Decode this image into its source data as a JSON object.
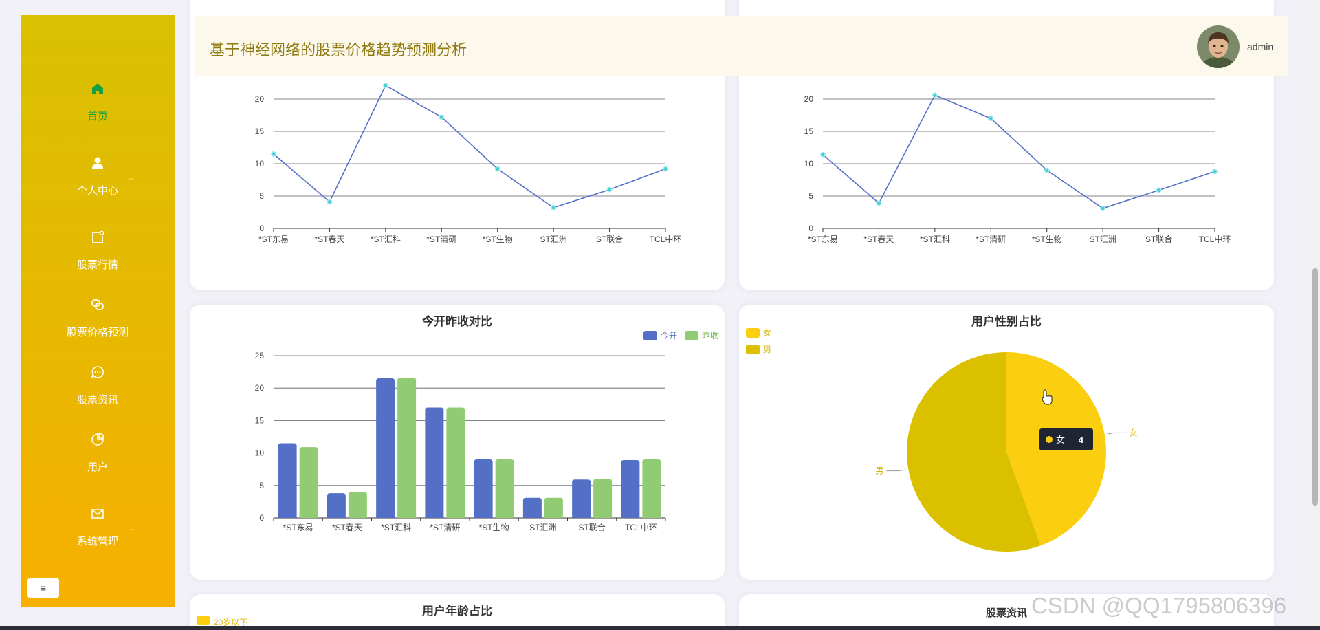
{
  "header": {
    "title": "基于神经网络的股票价格趋势预测分析",
    "username": "admin"
  },
  "sidebar": {
    "items": [
      {
        "label": "首页",
        "icon": "home-icon",
        "active": true
      },
      {
        "label": "个人中心",
        "icon": "user-icon"
      },
      {
        "label": "股票行情",
        "icon": "stock-doc-icon"
      },
      {
        "label": "股票价格预测",
        "icon": "link-icon"
      },
      {
        "label": "股票资讯",
        "icon": "chat-icon"
      },
      {
        "label": "用户",
        "icon": "pie-icon"
      },
      {
        "label": "系统管理",
        "icon": "mail-icon"
      }
    ],
    "collapse_label": "≡",
    "colors": {
      "top": "#d9c000",
      "bottom": "#f7b000",
      "active_text": "#14a047"
    }
  },
  "chart_data": [
    {
      "type": "line",
      "categories": [
        "*ST东易",
        "*ST春天",
        "*ST汇科",
        "*ST清研",
        "*ST生物",
        "ST汇洲",
        "ST联合",
        "TCL中环"
      ],
      "values": [
        11.5,
        4.1,
        22.1,
        17.2,
        9.2,
        3.2,
        6.0,
        9.2
      ],
      "ylim": [
        0,
        20
      ],
      "yticks": [
        0,
        5,
        10,
        15,
        20
      ],
      "grid": true
    },
    {
      "type": "line",
      "categories": [
        "*ST东易",
        "*ST春天",
        "*ST汇科",
        "*ST清研",
        "*ST生物",
        "ST汇洲",
        "ST联合",
        "TCL中环"
      ],
      "values": [
        11.4,
        3.9,
        20.6,
        17.0,
        9.0,
        3.1,
        5.9,
        8.8
      ],
      "ylim": [
        0,
        20
      ],
      "yticks": [
        0,
        5,
        10,
        15,
        20
      ],
      "grid": true
    },
    {
      "type": "bar",
      "title": "今开昨收对比",
      "categories": [
        "*ST东易",
        "*ST春天",
        "*ST汇科",
        "*ST清研",
        "*ST生物",
        "ST汇洲",
        "ST联合",
        "TCL中环"
      ],
      "series": [
        {
          "name": "今开",
          "color": "#5470c6",
          "values": [
            11.5,
            3.8,
            21.5,
            17.0,
            9.0,
            3.1,
            5.9,
            8.9
          ]
        },
        {
          "name": "昨收",
          "color": "#91cc75",
          "values": [
            10.9,
            4.0,
            21.6,
            17.0,
            9.0,
            3.1,
            6.0,
            9.0
          ]
        }
      ],
      "ylim": [
        0,
        25
      ],
      "yticks": [
        0,
        5,
        10,
        15,
        20,
        25
      ],
      "legend": "top-right",
      "grid": true
    },
    {
      "type": "pie",
      "title": "用户性别占比",
      "slices": [
        {
          "name": "女",
          "value": 4,
          "color": "#fcce10"
        },
        {
          "name": "男",
          "value": 5,
          "color": "#dbc000"
        }
      ],
      "legend": "top-left",
      "tooltip": {
        "name": "女",
        "value": 4
      }
    },
    {
      "type": "pie",
      "title": "用户年龄占比",
      "legend_visible": [
        "20岁以下"
      ]
    }
  ],
  "news_panel": {
    "title": "股票资讯"
  },
  "watermark": "CSDN @QQ1795806396"
}
